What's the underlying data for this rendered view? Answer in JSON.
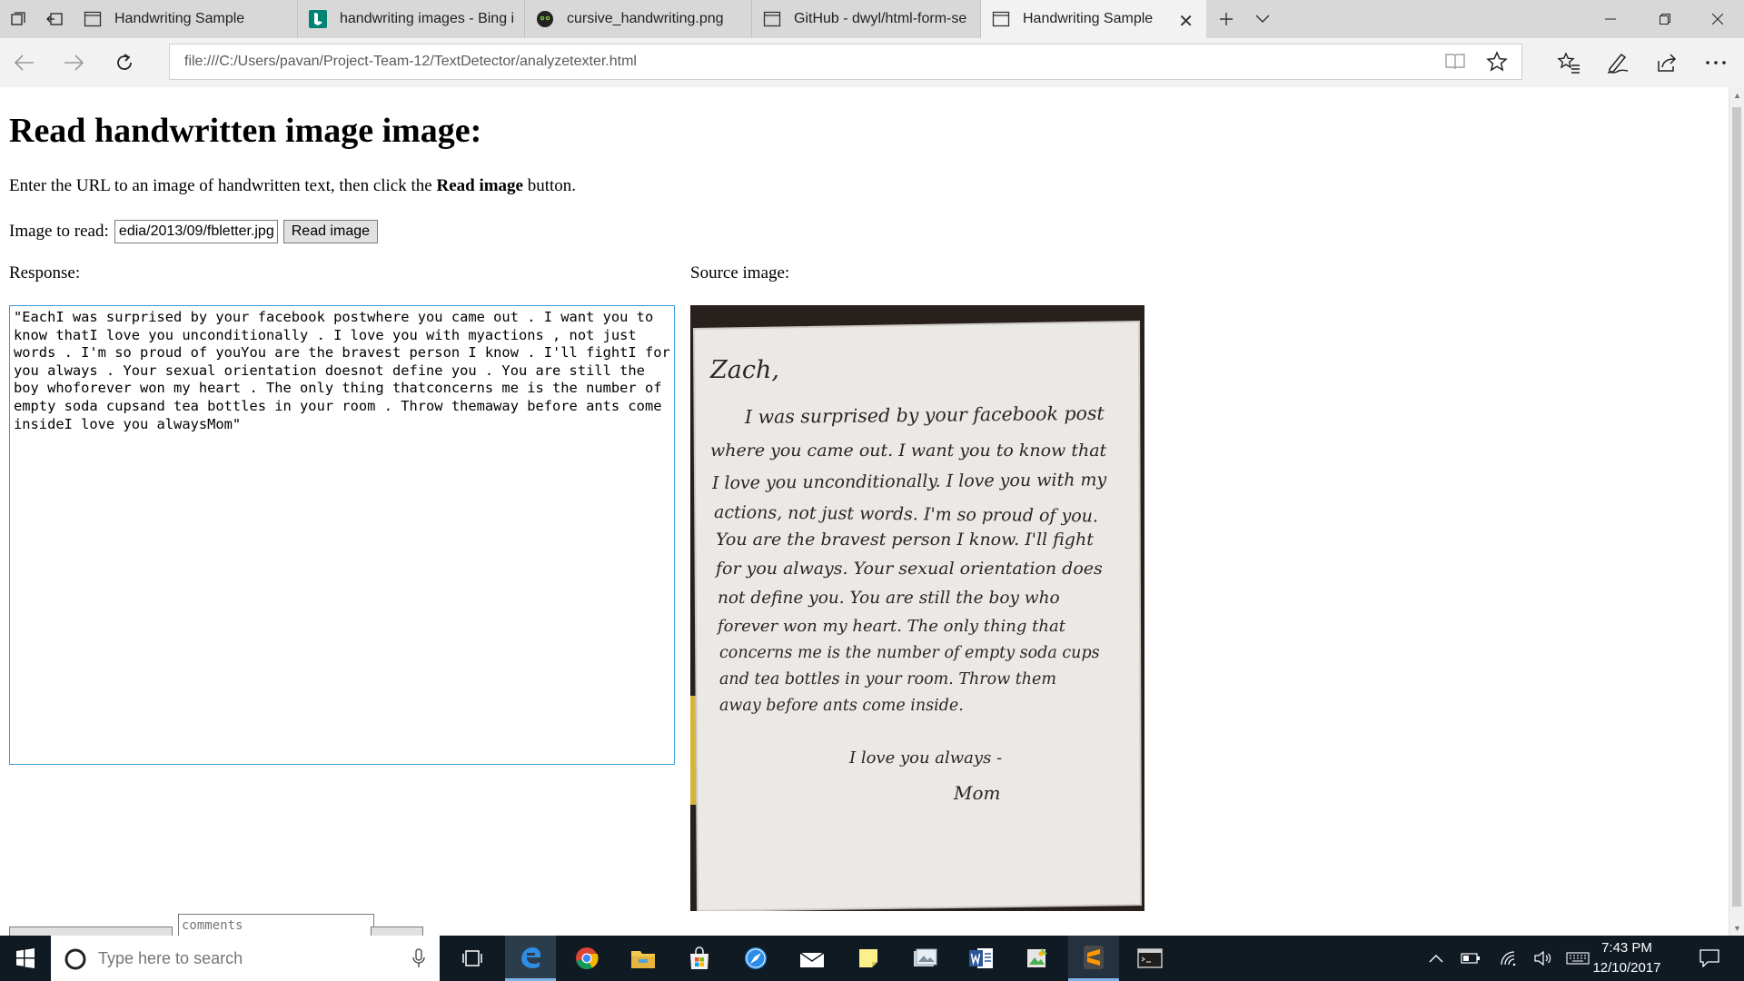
{
  "browser": {
    "tabs": [
      {
        "label": "Handwriting Sample",
        "icon": "page-icon"
      },
      {
        "label": "handwriting images - Bing i",
        "icon": "bing-icon"
      },
      {
        "label": "cursive_handwriting.png",
        "icon": "github-icon"
      },
      {
        "label": "GitHub - dwyl/html-form-se",
        "icon": "page-icon"
      },
      {
        "label": "Handwriting Sample",
        "icon": "page-icon",
        "active": true,
        "close": "✕"
      }
    ],
    "address": "file:///C:/Users/pavan/Project-Team-12/TextDetector/analyzetexter.html",
    "colors": {
      "tab_strip": "#d8d8d8",
      "toolbar": "#f2f2f2",
      "accent": "#0078d7"
    }
  },
  "page": {
    "heading": "Read handwritten image image:",
    "intro_before": "Enter the URL to an image of handwritten text, then click the ",
    "intro_bold": "Read image",
    "intro_after": " button.",
    "image_label": "Image to read:",
    "image_url_value": "edia/2013/09/fbletter.jpg",
    "read_button": "Read image",
    "response_label": "Response:",
    "source_label": "Source image:",
    "response_text": "\"EachI was surprised by your facebook postwhere you came out . I want you to know thatI love you unconditionally . I love you with myactions , not just words . I'm so proud of youYou are the bravest person I know . I'll fightI for you always . Your sexual orientation doesnot define you . You are still the boy whoforever won my heart . The only thing thatconcerns me is the number of empty soda cupsand tea bottles in your room . Throw themaway before ants come insideI love you alwaysMom\"",
    "comments_placeholder": "comments",
    "letter": {
      "lines": [
        "Zach,",
        "I was surprised by your facebook post",
        "where you came out. I want you to know that",
        "I love you unconditionally. I love you with my",
        "actions, not just words. I'm so proud of you.",
        "You are the bravest person I know. I'll fight",
        "for you always. Your sexual orientation does",
        "not define you. You are still the boy who",
        "forever won my heart. The only thing that",
        "concerns me is the number of empty soda cups",
        "and tea bottles in your room. Throw them",
        "away before ants come inside.",
        "I love you always -",
        "Mom"
      ]
    }
  },
  "taskbar": {
    "search_placeholder": "Type here to search",
    "time": "7:43 PM",
    "date": "12/10/2017",
    "apps": [
      "edge-icon",
      "chrome-icon",
      "file-explorer-icon",
      "store-icon",
      "safari-icon",
      "mail-icon",
      "sticky-notes-icon",
      "photos-icon",
      "word-icon",
      "image-editor-icon",
      "sublime-text-icon",
      "terminal-icon"
    ],
    "tray": [
      "chevron-up-icon",
      "battery-icon",
      "wifi-icon",
      "volume-icon",
      "keyboard-icon",
      "notifications-icon"
    ]
  }
}
